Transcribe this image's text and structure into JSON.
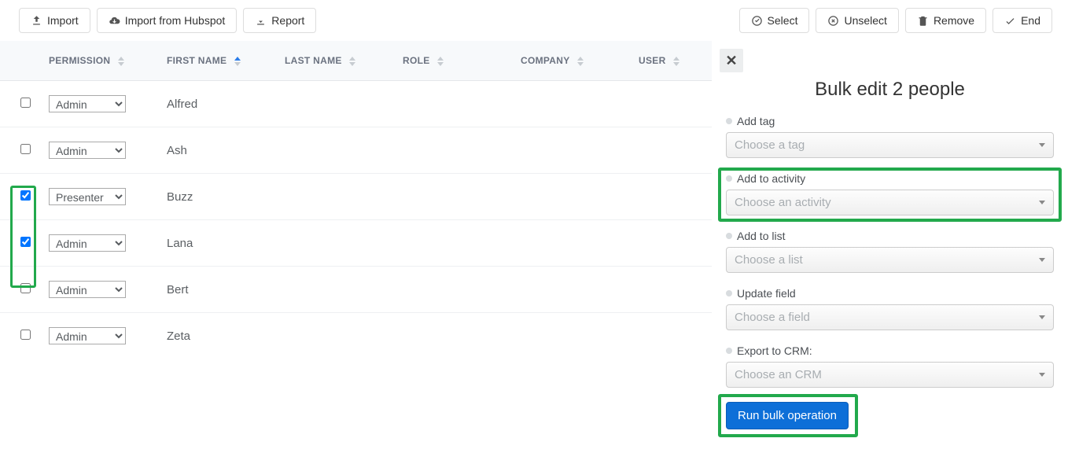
{
  "toolbar": {
    "import": "Import",
    "import_hubspot": "Import from Hubspot",
    "report": "Report",
    "select": "Select",
    "unselect": "Unselect",
    "remove": "Remove",
    "end": "End"
  },
  "table": {
    "headers": {
      "permission": "PERMISSION",
      "first_name": "FIRST NAME",
      "last_name": "LAST NAME",
      "role": "ROLE",
      "company": "COMPANY",
      "user": "USER"
    },
    "rows": [
      {
        "checked": false,
        "permission": "Admin",
        "first_name": "Alfred",
        "last_name": "",
        "role": "",
        "company": "",
        "user": ""
      },
      {
        "checked": false,
        "permission": "Admin",
        "first_name": "Ash",
        "last_name": "",
        "role": "",
        "company": "",
        "user": ""
      },
      {
        "checked": true,
        "permission": "Presenter",
        "first_name": "Buzz",
        "last_name": "",
        "role": "",
        "company": "",
        "user": ""
      },
      {
        "checked": true,
        "permission": "Admin",
        "first_name": "Lana",
        "last_name": "",
        "role": "",
        "company": "",
        "user": ""
      },
      {
        "checked": false,
        "permission": "Admin",
        "first_name": "Bert",
        "last_name": "",
        "role": "",
        "company": "",
        "user": ""
      },
      {
        "checked": false,
        "permission": "Admin",
        "first_name": "Zeta",
        "last_name": "",
        "role": "",
        "company": "",
        "user": ""
      }
    ],
    "permission_options": [
      "Admin",
      "Presenter"
    ]
  },
  "panel": {
    "title": "Bulk edit 2 people",
    "fields": {
      "add_tag": {
        "label": "Add tag",
        "placeholder": "Choose a tag"
      },
      "add_activity": {
        "label": "Add to activity",
        "placeholder": "Choose an activity"
      },
      "add_list": {
        "label": "Add to list",
        "placeholder": "Choose a list"
      },
      "update_field": {
        "label": "Update field",
        "placeholder": "Choose a field"
      },
      "export_crm": {
        "label": "Export to CRM:",
        "placeholder": "Choose an CRM"
      }
    },
    "run_button": "Run bulk operation"
  }
}
